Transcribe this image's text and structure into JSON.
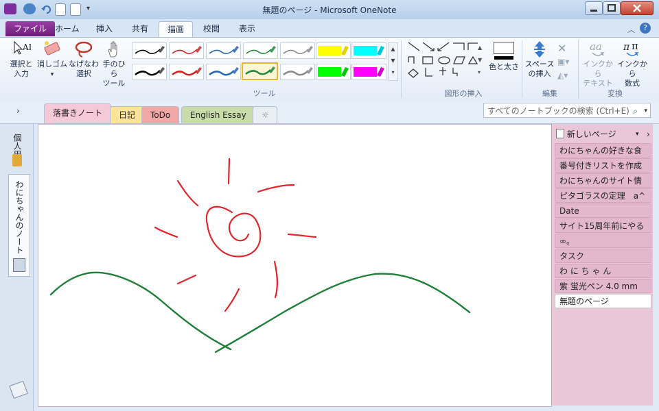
{
  "window": {
    "title": "無題のページ - Microsoft OneNote"
  },
  "ribbon_tabs": [
    "ファイル",
    "ホーム",
    "挿入",
    "共有",
    "描画",
    "校閲",
    "表示"
  ],
  "ribbon": {
    "tools": {
      "select_label_1": "選択と",
      "select_label_2": "入力",
      "eraser_label": "消しゴム",
      "lasso_label_1": "なげなわ",
      "lasso_label_2": "選択",
      "pan_label_1": "手のひら",
      "pan_label_2": "ツール",
      "group_label": "ツール"
    },
    "pens": {
      "row1": [
        "#000000",
        "#d32020",
        "#2566b3",
        "#1e8a3a",
        "#808080",
        "#ffff00",
        "#00ffff"
      ],
      "row2": [
        "#000000",
        "#d32020",
        "#2566b3",
        "#1e8a3a",
        "#808080",
        "#00ff00",
        "#ff00ff"
      ],
      "selected": "green-pen-row2"
    },
    "shapes": {
      "group_label": "図形の挿入",
      "color_label": "色と太さ"
    },
    "edit": {
      "space_label_1": "スペース",
      "space_label_2": "の挿入",
      "group_label": "編集"
    },
    "convert": {
      "ink_text_label_1": "インクから",
      "ink_text_label_2": "テキスト",
      "ink_math_label_1": "インクから",
      "ink_math_label_2": "数式",
      "group_label": "変換"
    }
  },
  "sections": [
    {
      "label": "落書きノート",
      "color": "#f5c9d8"
    },
    {
      "label": "日記",
      "color": "#fbe49a"
    },
    {
      "label": "ToDo",
      "color": "#f2a7a7"
    },
    {
      "label": "English Essay",
      "color": "#c8dcaa"
    }
  ],
  "search": {
    "placeholder": "すべてのノートブックの検索 (Ctrl+E)"
  },
  "notebooks": [
    "個人用",
    "わにちゃんのノート"
  ],
  "pages": {
    "new_page_label": "新しいページ",
    "items": [
      "わにちゃんの好きな食",
      "番号付きリストを作成",
      "わにちゃんのサイト情",
      "ピタゴラスの定理　a^",
      "Date",
      "サイト15周年前にやる",
      "∞。",
      "タスク",
      "わ に ち ゃ ん",
      "紫 蛍光ペン 4.0 mm",
      "無題のページ"
    ],
    "active_index": 10
  },
  "ink": {
    "sun_color": "#e0262b",
    "hills_color": "#1f7f38"
  }
}
